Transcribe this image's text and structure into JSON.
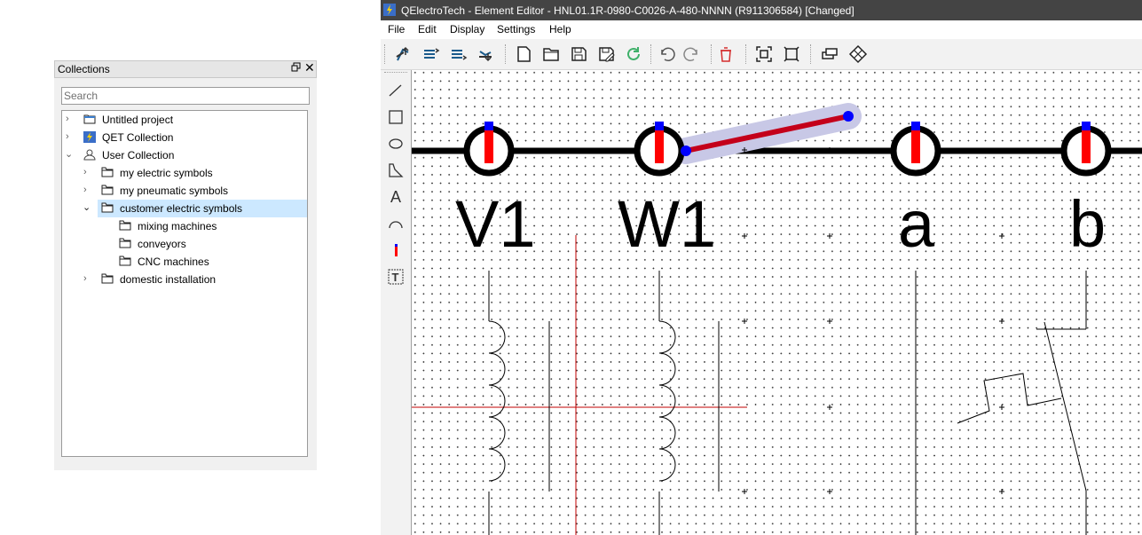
{
  "collections_panel": {
    "title": "Collections",
    "search_placeholder": "Search",
    "tree": [
      {
        "label": "Untitled project"
      },
      {
        "label": "QET Collection"
      },
      {
        "label": "User Collection"
      },
      {
        "label": "my electric symbols"
      },
      {
        "label": "my pneumatic symbols"
      },
      {
        "label": "customer electric symbols"
      },
      {
        "label": "mixing machines"
      },
      {
        "label": "conveyors"
      },
      {
        "label": "CNC machines"
      },
      {
        "label": "domestic installation"
      }
    ]
  },
  "editor": {
    "title": "QElectroTech - Element Editor - HNL01.1R-0980-C0026-A-480-NNNN (R911306584) [Changed]",
    "menu": [
      "File",
      "Edit",
      "Display",
      "Settings",
      "Help"
    ],
    "toolbar_icons": [
      "raise-to-top-icon",
      "raise-icon",
      "lower-icon",
      "lower-to-bottom-icon",
      "new-element-icon",
      "open-icon",
      "save-icon",
      "save-as-icon",
      "reload-icon",
      "undo-icon",
      "redo-icon",
      "delete-icon",
      "zoom-fit-icon",
      "zoom-reset-icon",
      "edit-info-icon",
      "edit-names-icon"
    ],
    "drawing_tools": [
      "line-tool-icon",
      "rectangle-tool-icon",
      "ellipse-tool-icon",
      "polygon-tool-icon",
      "text-tool-icon",
      "arc-tool-icon",
      "terminal-tool-icon",
      "dynamic-text-tool-icon"
    ],
    "canvas": {
      "terminal_labels": [
        "V1",
        "W1",
        "a",
        "b"
      ]
    }
  },
  "colors": {
    "titlebar": "#444444",
    "selection": "#cce8ff",
    "terminal_red": "#ff0000",
    "terminal_blue": "#0000ff"
  }
}
